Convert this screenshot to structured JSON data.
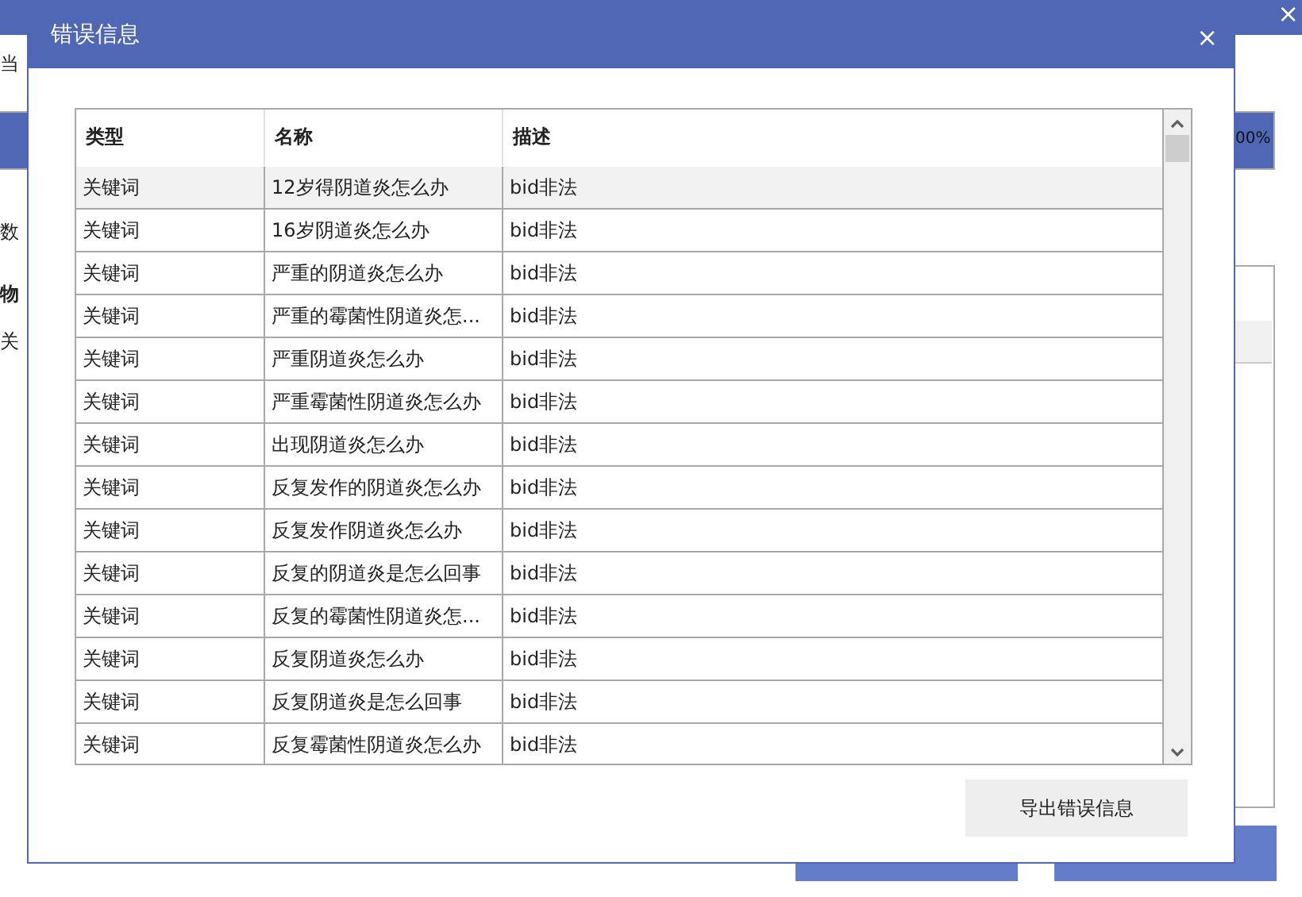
{
  "background_window": {
    "close": "×",
    "labels": [
      "当",
      "数",
      "物",
      "关"
    ],
    "progress": {
      "level": 1,
      "text": "00%"
    }
  },
  "dialog": {
    "title": "错误信息",
    "close": "×",
    "table": {
      "columns": [
        "类型",
        "名称",
        "描述"
      ],
      "rows": [
        {
          "cells": [
            "关键词",
            "12岁得阴道炎怎么办",
            "bid非法"
          ],
          "selected": true
        },
        {
          "cells": [
            "关键词",
            "16岁阴道炎怎么办",
            "bid非法"
          ],
          "selected": false
        },
        {
          "cells": [
            "关键词",
            "严重的阴道炎怎么办",
            "bid非法"
          ],
          "selected": false
        },
        {
          "cells": [
            "关键词",
            "严重的霉菌性阴道炎怎...",
            "bid非法"
          ],
          "selected": false
        },
        {
          "cells": [
            "关键词",
            "严重阴道炎怎么办",
            "bid非法"
          ],
          "selected": false
        },
        {
          "cells": [
            "关键词",
            "严重霉菌性阴道炎怎么办",
            "bid非法"
          ],
          "selected": false
        },
        {
          "cells": [
            "关键词",
            "出现阴道炎怎么办",
            "bid非法"
          ],
          "selected": false
        },
        {
          "cells": [
            "关键词",
            "反复发作的阴道炎怎么办",
            "bid非法"
          ],
          "selected": false
        },
        {
          "cells": [
            "关键词",
            "反复发作阴道炎怎么办",
            "bid非法"
          ],
          "selected": false
        },
        {
          "cells": [
            "关键词",
            "反复的阴道炎是怎么回事",
            "bid非法"
          ],
          "selected": false
        },
        {
          "cells": [
            "关键词",
            "反复的霉菌性阴道炎怎...",
            "bid非法"
          ],
          "selected": false
        },
        {
          "cells": [
            "关键词",
            "反复阴道炎怎么办",
            "bid非法"
          ],
          "selected": false
        },
        {
          "cells": [
            "关键词",
            "反复阴道炎是怎么回事",
            "bid非法"
          ],
          "selected": false
        },
        {
          "cells": [
            "关键词",
            "反复霉菌性阴道炎怎么办",
            "bid非法"
          ],
          "selected": false
        }
      ]
    },
    "buttons": [
      "导出错误信息"
    ]
  }
}
